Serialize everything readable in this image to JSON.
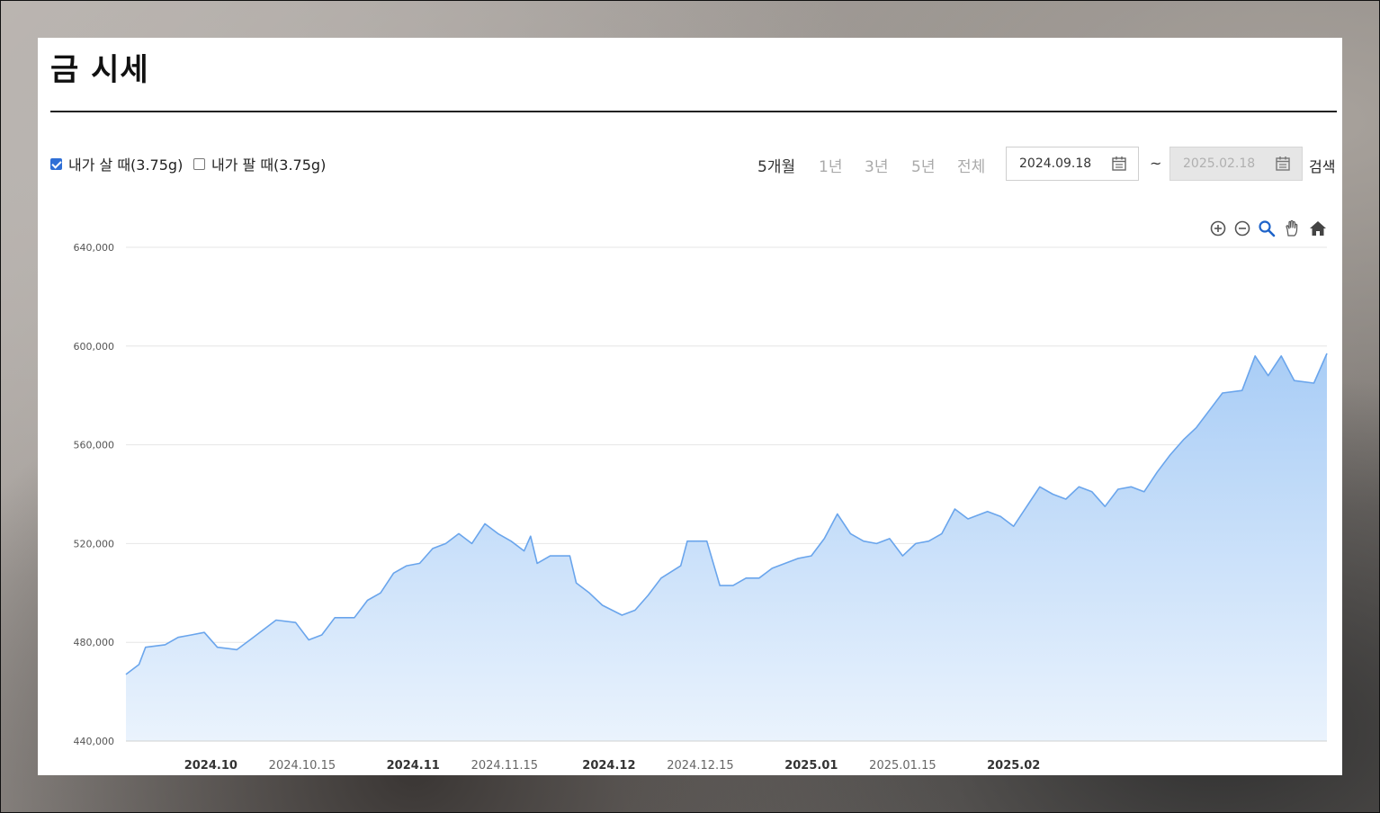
{
  "page": {
    "title": "금 시세"
  },
  "filters": {
    "buy": {
      "label": "내가 살 때(3.75g)",
      "checked": true
    },
    "sell": {
      "label": "내가 팔 때(3.75g)",
      "checked": false
    }
  },
  "periods": [
    {
      "label": "5개월",
      "active": true
    },
    {
      "label": "1년",
      "active": false
    },
    {
      "label": "3년",
      "active": false
    },
    {
      "label": "5년",
      "active": false
    },
    {
      "label": "전체",
      "active": false
    }
  ],
  "date_range": {
    "start": "2024.09.18",
    "separator": "~",
    "end": "2025.02.18",
    "end_disabled": true
  },
  "search_label": "검색",
  "toolbar_icons": [
    "zoom-in-icon",
    "zoom-out-icon",
    "magnify-icon",
    "pan-hand-icon",
    "home-icon"
  ],
  "colors": {
    "line": "#6aa5ec",
    "fill_top": "#a9cdf6",
    "fill_bottom": "#eaf3fd",
    "checkbox": "#2f6fd6"
  },
  "chart_data": {
    "type": "area",
    "title": "",
    "xlabel": "",
    "ylabel": "",
    "x_range": [
      "2024-09-18",
      "2025-02-18"
    ],
    "ylim": [
      440000,
      640000
    ],
    "y_ticks": [
      {
        "value": 440000,
        "label": "440,000"
      },
      {
        "value": 480000,
        "label": "480,000"
      },
      {
        "value": 520000,
        "label": "520,000"
      },
      {
        "value": 560000,
        "label": "560,000"
      },
      {
        "value": 600000,
        "label": "600,000"
      },
      {
        "value": 640000,
        "label": "640,000"
      }
    ],
    "x_ticks": [
      {
        "date": "2024-10-01",
        "label": "2024.10",
        "major": true
      },
      {
        "date": "2024-10-15",
        "label": "2024.10.15",
        "major": false
      },
      {
        "date": "2024-11-01",
        "label": "2024.11",
        "major": true
      },
      {
        "date": "2024-11-15",
        "label": "2024.11.15",
        "major": false
      },
      {
        "date": "2024-12-01",
        "label": "2024.12",
        "major": true
      },
      {
        "date": "2024-12-15",
        "label": "2024.12.15",
        "major": false
      },
      {
        "date": "2025-01-01",
        "label": "2025.01",
        "major": true
      },
      {
        "date": "2025-01-15",
        "label": "2025.01.15",
        "major": false
      },
      {
        "date": "2025-02-01",
        "label": "2025.02",
        "major": true
      }
    ],
    "grid": true,
    "series": [
      {
        "points": [
          [
            "2024-09-18",
            467000
          ],
          [
            "2024-09-20",
            471000
          ],
          [
            "2024-09-21",
            478000
          ],
          [
            "2024-09-24",
            479000
          ],
          [
            "2024-09-26",
            482000
          ],
          [
            "2024-09-28",
            483000
          ],
          [
            "2024-09-30",
            484000
          ],
          [
            "2024-10-02",
            478000
          ],
          [
            "2024-10-05",
            477000
          ],
          [
            "2024-10-07",
            481000
          ],
          [
            "2024-10-09",
            485000
          ],
          [
            "2024-10-11",
            489000
          ],
          [
            "2024-10-14",
            488000
          ],
          [
            "2024-10-16",
            481000
          ],
          [
            "2024-10-18",
            483000
          ],
          [
            "2024-10-20",
            490000
          ],
          [
            "2024-10-23",
            490000
          ],
          [
            "2024-10-25",
            497000
          ],
          [
            "2024-10-27",
            500000
          ],
          [
            "2024-10-29",
            508000
          ],
          [
            "2024-10-31",
            511000
          ],
          [
            "2024-11-02",
            512000
          ],
          [
            "2024-11-04",
            518000
          ],
          [
            "2024-11-06",
            520000
          ],
          [
            "2024-11-08",
            524000
          ],
          [
            "2024-11-10",
            520000
          ],
          [
            "2024-11-12",
            528000
          ],
          [
            "2024-11-14",
            524000
          ],
          [
            "2024-11-16",
            521000
          ],
          [
            "2024-11-18",
            517000
          ],
          [
            "2024-11-19",
            523000
          ],
          [
            "2024-11-20",
            512000
          ],
          [
            "2024-11-22",
            515000
          ],
          [
            "2024-11-25",
            515000
          ],
          [
            "2024-11-26",
            504000
          ],
          [
            "2024-11-28",
            500000
          ],
          [
            "2024-11-30",
            495000
          ],
          [
            "2024-12-03",
            491000
          ],
          [
            "2024-12-05",
            493000
          ],
          [
            "2024-12-07",
            499000
          ],
          [
            "2024-12-09",
            506000
          ],
          [
            "2024-12-12",
            511000
          ],
          [
            "2024-12-13",
            521000
          ],
          [
            "2024-12-16",
            521000
          ],
          [
            "2024-12-18",
            503000
          ],
          [
            "2024-12-20",
            503000
          ],
          [
            "2024-12-22",
            506000
          ],
          [
            "2024-12-24",
            506000
          ],
          [
            "2024-12-26",
            510000
          ],
          [
            "2024-12-28",
            512000
          ],
          [
            "2024-12-30",
            514000
          ],
          [
            "2025-01-01",
            515000
          ],
          [
            "2025-01-03",
            522000
          ],
          [
            "2025-01-05",
            532000
          ],
          [
            "2025-01-07",
            524000
          ],
          [
            "2025-01-09",
            521000
          ],
          [
            "2025-01-11",
            520000
          ],
          [
            "2025-01-13",
            522000
          ],
          [
            "2025-01-15",
            515000
          ],
          [
            "2025-01-17",
            520000
          ],
          [
            "2025-01-19",
            521000
          ],
          [
            "2025-01-21",
            524000
          ],
          [
            "2025-01-23",
            534000
          ],
          [
            "2025-01-25",
            530000
          ],
          [
            "2025-01-28",
            533000
          ],
          [
            "2025-01-30",
            531000
          ],
          [
            "2025-02-01",
            527000
          ],
          [
            "2025-02-03",
            535000
          ],
          [
            "2025-02-05",
            543000
          ],
          [
            "2025-02-07",
            540000
          ],
          [
            "2025-02-09",
            538000
          ],
          [
            "2025-02-11",
            543000
          ],
          [
            "2025-02-13",
            541000
          ],
          [
            "2025-02-15",
            535000
          ],
          [
            "2025-02-17",
            542000
          ],
          [
            "2025-02-19",
            543000
          ],
          [
            "2025-02-21",
            541000
          ],
          [
            "2025-02-23",
            549000
          ],
          [
            "2025-02-25",
            556000
          ],
          [
            "2025-02-27",
            562000
          ],
          [
            "2025-03-01",
            567000
          ],
          [
            "2025-03-03",
            574000
          ],
          [
            "2025-03-05",
            581000
          ],
          [
            "2025-03-08",
            582000
          ],
          [
            "2025-03-10",
            596000
          ],
          [
            "2025-03-12",
            588000
          ],
          [
            "2025-03-14",
            596000
          ],
          [
            "2025-03-16",
            586000
          ],
          [
            "2025-03-19",
            585000
          ],
          [
            "2025-03-21",
            597000
          ]
        ]
      }
    ]
  }
}
